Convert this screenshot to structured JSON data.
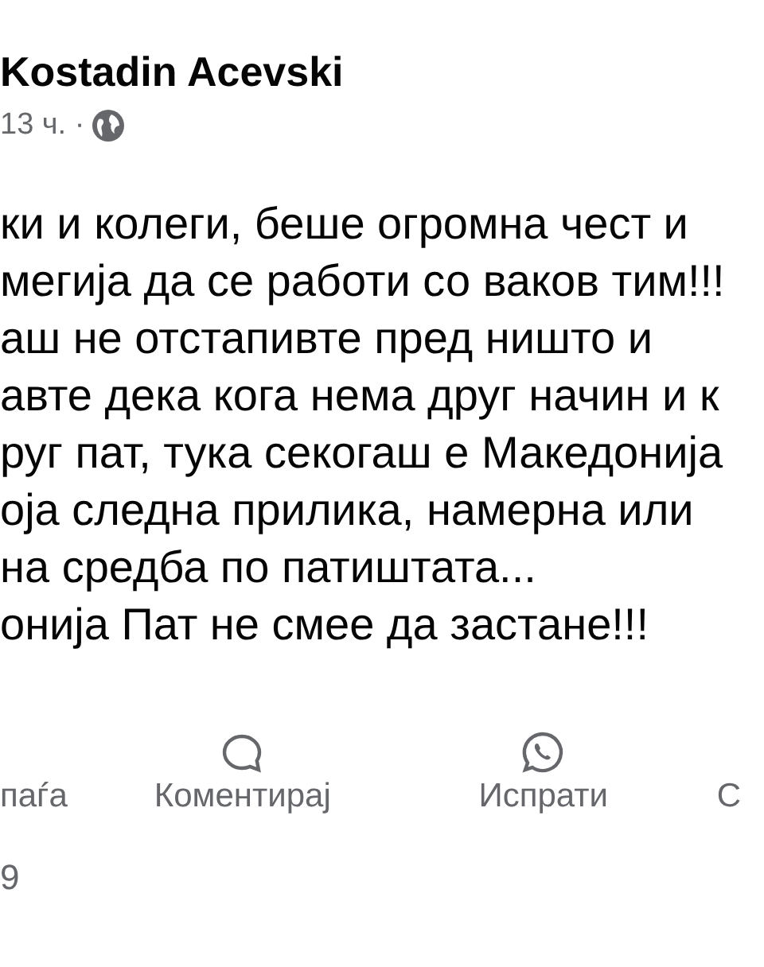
{
  "post": {
    "author": "Kostadin Acevski",
    "time": "13 ч. ·",
    "lines": [
      "ки и колеги, беше огромна чест и",
      "мегија да се работи со ваков тим!!!",
      "аш не отстапивте пред ништо и",
      "авте дека кога нема друг начин и к",
      "руг пат, тука секогаш е Македонија",
      "оја следна прилика, намерна или",
      "на средба по патиштата...",
      "онија Пат не смее да застане!!!"
    ]
  },
  "actions": [
    {
      "label": "паѓа",
      "kind": "plain"
    },
    {
      "label": "Коментирај",
      "kind": "comment"
    },
    {
      "label": "Испрати",
      "kind": "whatsapp"
    },
    {
      "label": "С",
      "kind": "plain"
    }
  ],
  "footer": "9"
}
